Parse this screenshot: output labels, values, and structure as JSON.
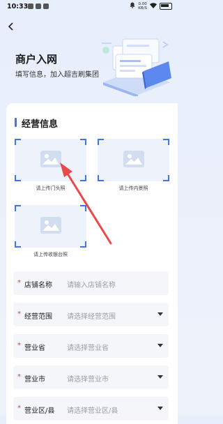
{
  "status_bar": {
    "time": "10:33",
    "net_speed_top": "0.00",
    "net_speed_bottom": "KB/S"
  },
  "header": {
    "title": "商户入网",
    "subtitle": "填写信息，加入超吉刷集团"
  },
  "section": {
    "title": "经营信息"
  },
  "uploads": [
    {
      "label": "请上传门头照"
    },
    {
      "label": "请上传内景照"
    },
    {
      "label": "请上传收银台照"
    }
  ],
  "form": [
    {
      "label": "店铺名称",
      "placeholder": "请输入店铺名称",
      "type": "input"
    },
    {
      "label": "经营范围",
      "placeholder": "请选择经营范围",
      "type": "select"
    },
    {
      "label": "营业省",
      "placeholder": "请选择营业省",
      "type": "select"
    },
    {
      "label": "营业市",
      "placeholder": "请选择营业市",
      "type": "select"
    },
    {
      "label": "营业区/县",
      "placeholder": "请选择营业区/县",
      "type": "select"
    }
  ],
  "colors": {
    "accent": "#3f74f0",
    "required": "#e23b3b",
    "annotation_arrow": "#e84a4a"
  }
}
